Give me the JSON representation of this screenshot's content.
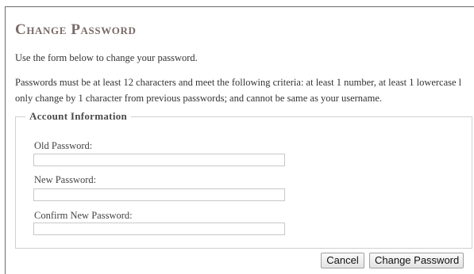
{
  "page": {
    "title": "Change Password",
    "intro": "Use the form below to change your password.",
    "criteria_line1": "Passwords must be at least 12 characters and meet the following criteria: at least 1 number, at least 1 lowercase l",
    "criteria_line2": "only change by 1 character from previous passwords; and cannot be same as your username."
  },
  "form": {
    "legend": "Account Information",
    "fields": [
      {
        "label": "Old Password:",
        "value": "",
        "placeholder": ""
      },
      {
        "label": "New Password:",
        "value": "",
        "placeholder": ""
      },
      {
        "label": "Confirm New Password:",
        "value": "",
        "placeholder": ""
      }
    ]
  },
  "buttons": {
    "cancel_label": "Cancel",
    "change_label": "Change Password"
  },
  "colors": {
    "title": "#7a6a68",
    "text": "#333333",
    "fieldset_border": "#d0d0d0"
  }
}
